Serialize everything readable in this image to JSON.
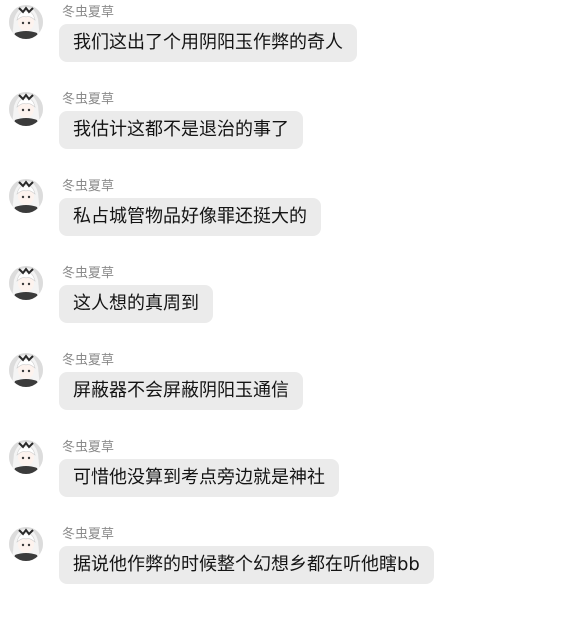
{
  "conversation": {
    "messages": [
      {
        "sender": "冬虫夏草",
        "text": "我们这出了个用阴阳玉作弊的奇人",
        "avatar_icon": "anime-girl-avatar-icon"
      },
      {
        "sender": "冬虫夏草",
        "text": "我估计这都不是退治的事了",
        "avatar_icon": "anime-girl-avatar-icon"
      },
      {
        "sender": "冬虫夏草",
        "text": "私占城管物品好像罪还挺大的",
        "avatar_icon": "anime-girl-avatar-icon"
      },
      {
        "sender": "冬虫夏草",
        "text": "这人想的真周到",
        "avatar_icon": "anime-girl-avatar-icon"
      },
      {
        "sender": "冬虫夏草",
        "text": "屏蔽器不会屏蔽阴阳玉通信",
        "avatar_icon": "anime-girl-avatar-icon"
      },
      {
        "sender": "冬虫夏草",
        "text": "可惜他没算到考点旁边就是神社",
        "avatar_icon": "anime-girl-avatar-icon"
      },
      {
        "sender": "冬虫夏草",
        "text": "据说他作弊的时候整个幻想乡都在听他瞎bb",
        "avatar_icon": "anime-girl-avatar-icon"
      }
    ]
  },
  "colors": {
    "background": "#ffffff",
    "bubble": "#ebebeb",
    "sender_name": "#8a8a8a",
    "message_text": "#141414"
  }
}
